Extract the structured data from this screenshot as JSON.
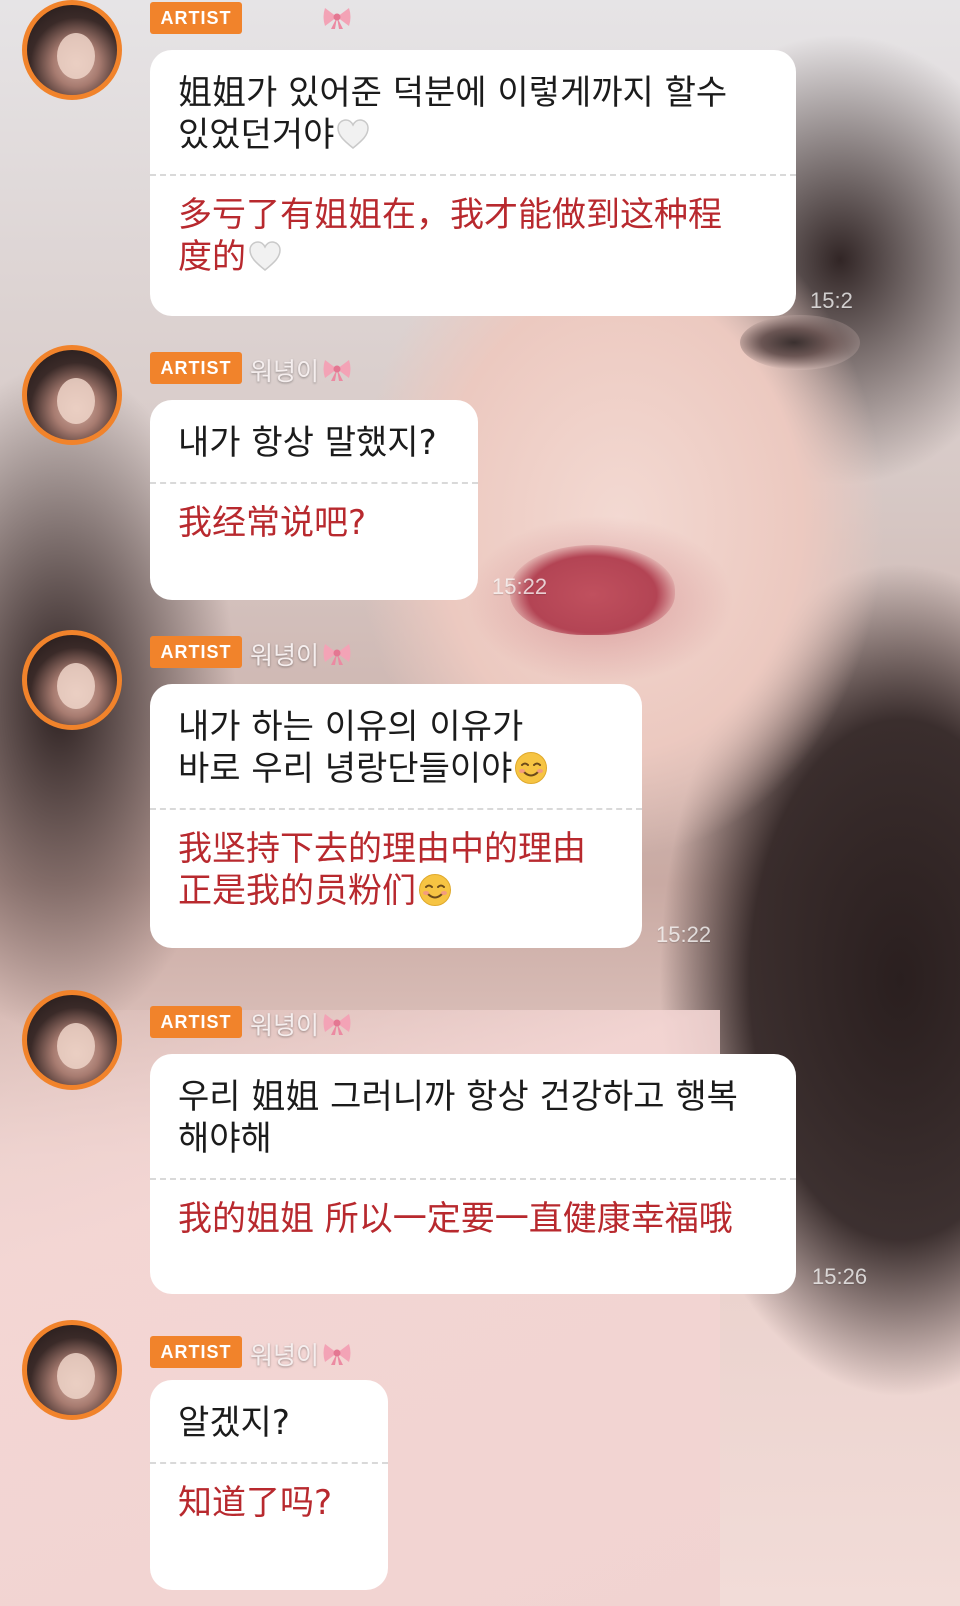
{
  "colors": {
    "badge": "#f1832b",
    "translation": "#b8292e",
    "text": "#1b1b1b",
    "bubble": "#ffffff"
  },
  "messages": [
    {
      "badge": "ARTIST",
      "name": "",
      "name_icon": "ribbon-bow",
      "korean": "姐姐가 있어준 덕분에 이렇게까지 할수\n있었던거야",
      "korean_emoji": "white-heart",
      "chinese": "多亏了有姐姐在，我才能做到这种程\n度的",
      "chinese_emoji": "white-heart",
      "time": "15:2"
    },
    {
      "badge": "ARTIST",
      "name": "워녕이",
      "name_icon": "ribbon-bow",
      "korean": "내가 항상 말했지?",
      "chinese": "我经常说吧?",
      "time": "15:22"
    },
    {
      "badge": "ARTIST",
      "name": "워녕이",
      "name_icon": "ribbon-bow",
      "korean": "내가 하는 이유의 이유가\n바로 우리 녕랑단들이야",
      "korean_emoji": "smiling-blush",
      "chinese": "我坚持下去的理由中的理由\n正是我的员粉们",
      "chinese_emoji": "smiling-blush",
      "time": "15:22"
    },
    {
      "badge": "ARTIST",
      "name": "워녕이",
      "name_icon": "ribbon-bow",
      "korean": "우리 姐姐 그러니까 항상 건강하고 행복\n해야해",
      "chinese": "我的姐姐 所以一定要一直健康幸福哦",
      "time": "15:26"
    },
    {
      "badge": "ARTIST",
      "name": "워녕이",
      "name_icon": "ribbon-bow",
      "korean": "알겠지?",
      "chinese": "知道了吗?",
      "time": ""
    }
  ]
}
